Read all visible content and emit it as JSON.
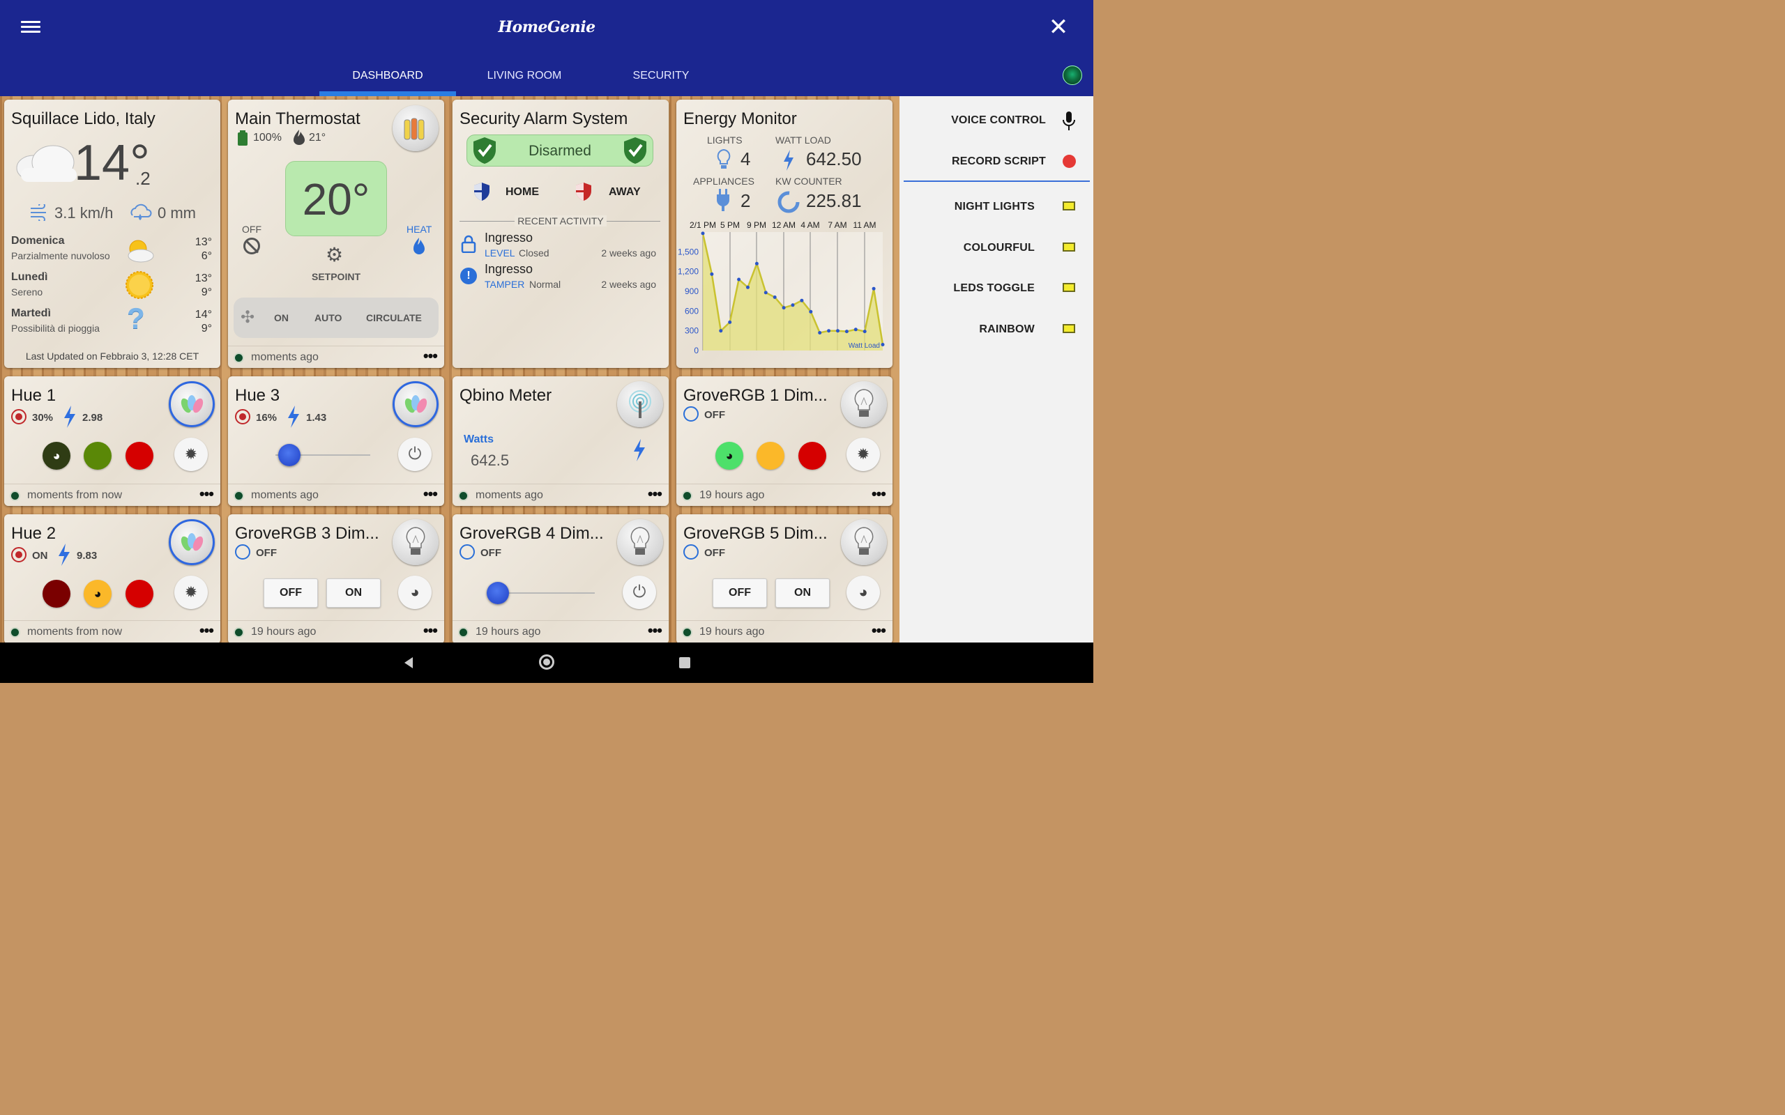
{
  "app": {
    "title": "HomeGenie"
  },
  "tabs": [
    {
      "label": "DASHBOARD"
    },
    {
      "label": "LIVING ROOM"
    },
    {
      "label": "SECURITY"
    }
  ],
  "colors": {
    "header": "#1b2690",
    "accent": "#2a7de3",
    "status_led": "#0e6c3d"
  },
  "weather": {
    "location": "Squillace Lido, Italy",
    "temp": "14°",
    "temp_decimal": ".2",
    "wind": "3.1 km/h",
    "rain": "0 mm",
    "forecast": [
      {
        "day": "Domenica",
        "desc": "Parzialmente nuvoloso",
        "hi": "13°",
        "lo": "6°",
        "icon": "partly-cloudy-icon"
      },
      {
        "day": "Lunedì",
        "desc": "Sereno",
        "hi": "13°",
        "lo": "9°",
        "icon": "sun-icon"
      },
      {
        "day": "Martedì",
        "desc": "Possibilità di pioggia",
        "hi": "14°",
        "lo": "9°",
        "icon": "rain-question-icon"
      }
    ],
    "updated": "Last Updated on Febbraio 3, 12:28 CET"
  },
  "thermostat": {
    "title": "Main Thermostat",
    "battery": "100%",
    "temp": "21°",
    "setpoint": "20°",
    "off_label": "OFF",
    "heat_label": "HEAT",
    "setpoint_label": "SETPOINT",
    "fan_modes": [
      "ON",
      "AUTO",
      "CIRCULATE"
    ],
    "footer": "moments ago"
  },
  "security": {
    "title": "Security Alarm System",
    "status": "Disarmed",
    "home": "HOME",
    "away": "AWAY",
    "recent_label": "RECENT ACTIVITY",
    "events": [
      {
        "name": "Ingresso",
        "type": "LEVEL",
        "value": "Closed",
        "time": "2 weeks ago"
      },
      {
        "name": "Ingresso",
        "type": "TAMPER",
        "value": "Normal",
        "time": "2 weeks ago"
      }
    ]
  },
  "energy": {
    "title": "Energy Monitor",
    "lights_label": "LIGHTS",
    "lights": "4",
    "watt_label": "WATT LOAD",
    "watt": "642.50",
    "appliances_label": "APPLIANCES",
    "appliances": "2",
    "kw_label": "KW COUNTER",
    "kw": "225.81",
    "chart_data": {
      "type": "area",
      "x_ticks": [
        "2/1 PM",
        "5 PM",
        "9 PM",
        "12 AM",
        "4 AM",
        "7 AM",
        "11 AM"
      ],
      "y_ticks": [
        "1,500",
        "1,200",
        "900",
        "600",
        "300",
        "0"
      ],
      "ylim": [
        0,
        1800
      ],
      "series": [
        {
          "name": "Watt Load",
          "values": [
            1780,
            1160,
            300,
            430,
            1080,
            960,
            1320,
            880,
            810,
            650,
            690,
            760,
            590,
            270,
            300,
            300,
            290,
            320,
            290,
            940,
            90
          ]
        }
      ],
      "color": "#c9c230"
    }
  },
  "hue1": {
    "title": "Hue 1",
    "level": "30%",
    "watts": "2.98",
    "footer": "moments from now"
  },
  "hue3": {
    "title": "Hue 3",
    "level": "16%",
    "watts": "1.43",
    "footer": "moments ago"
  },
  "qbino": {
    "title": "Qbino Meter",
    "label": "Watts",
    "value": "642.5",
    "footer": "moments ago"
  },
  "grove1": {
    "title": "GroveRGB 1 Dim...",
    "state": "OFF",
    "footer": "19 hours ago"
  },
  "hue2": {
    "title": "Hue 2",
    "level": "ON",
    "watts": "9.83",
    "footer": "moments from now"
  },
  "grove3": {
    "title": "GroveRGB 3 Dim...",
    "state": "OFF",
    "off_btn": "OFF",
    "on_btn": "ON",
    "footer": "19 hours ago"
  },
  "grove4": {
    "title": "GroveRGB 4 Dim...",
    "state": "OFF",
    "footer": "19 hours ago"
  },
  "grove5": {
    "title": "GroveRGB 5 Dim...",
    "state": "OFF",
    "off_btn": "OFF",
    "on_btn": "ON",
    "footer": "19 hours ago"
  },
  "sidebar": {
    "voice": "VOICE CONTROL",
    "record": "RECORD SCRIPT",
    "scripts": [
      {
        "label": "NIGHT LIGHTS"
      },
      {
        "label": "COLOURFUL"
      },
      {
        "label": "LEDS TOGGLE"
      },
      {
        "label": "RAINBOW"
      }
    ]
  }
}
